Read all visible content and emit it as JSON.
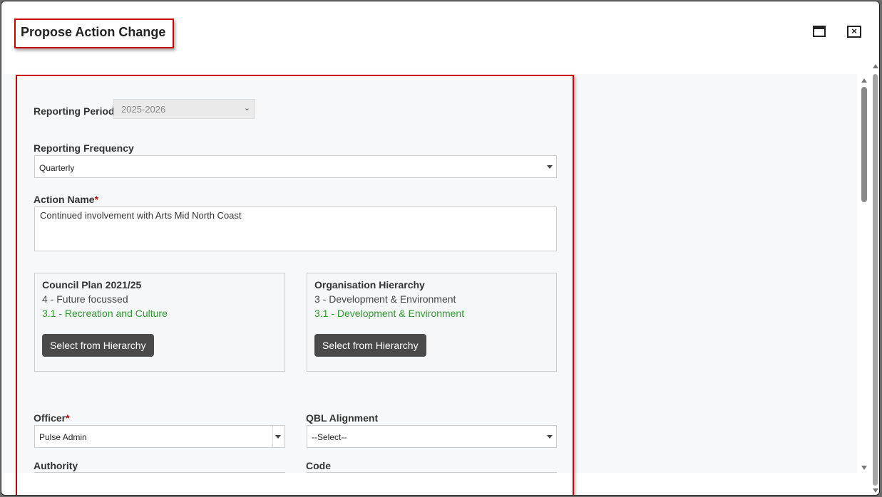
{
  "dialog": {
    "title": "Propose Action Change",
    "icons": {
      "maximize": "maximize-icon",
      "close": "close-icon"
    },
    "close_glyph": "×"
  },
  "form": {
    "reporting_period": {
      "label": "Reporting Period",
      "value": "2025-2026"
    },
    "reporting_frequency": {
      "label": "Reporting Frequency",
      "value": "Quarterly"
    },
    "action_name": {
      "label": "Action Name",
      "required_mark": "*",
      "value": "Continued involvement with Arts Mid North Coast"
    },
    "council_plan": {
      "title": "Council Plan 2021/25",
      "line1": "4 - Future focussed",
      "line2": "3.1 - Recreation and Culture",
      "button": "Select from Hierarchy"
    },
    "org_hierarchy": {
      "title": "Organisation Hierarchy",
      "line1": "3 - Development & Environment",
      "line2": "3.1 - Development & Environment",
      "button": "Select from Hierarchy"
    },
    "officer": {
      "label": "Officer",
      "required_mark": "*",
      "value": "Pulse Admin"
    },
    "qbl_alignment": {
      "label": "QBL Alignment",
      "value": "--Select--"
    },
    "authority": {
      "label": "Authority"
    },
    "code": {
      "label": "Code"
    }
  },
  "colors": {
    "highlight": "#d00000",
    "accent_green": "#2e9a2e",
    "button_bg": "#4a4a4a"
  }
}
